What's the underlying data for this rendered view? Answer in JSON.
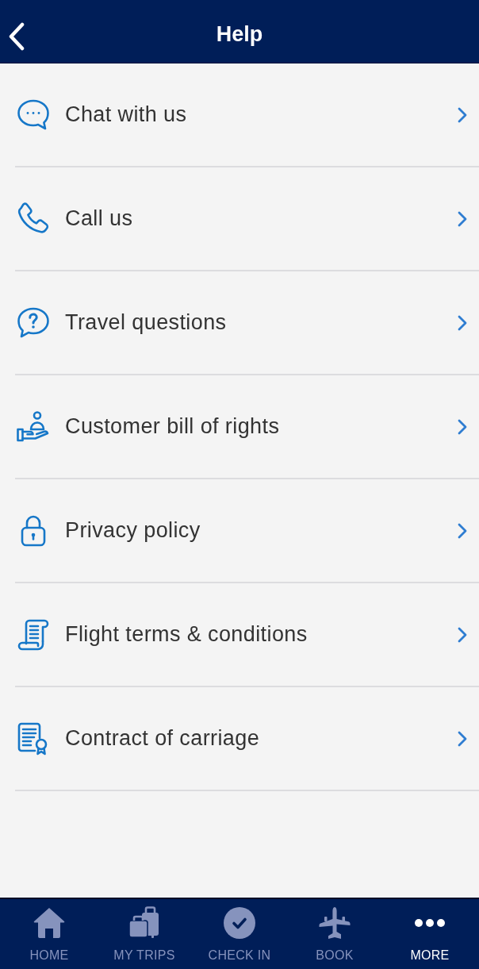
{
  "header": {
    "title": "Help"
  },
  "menu_items": [
    {
      "label": "Chat with us"
    },
    {
      "label": "Call us"
    },
    {
      "label": "Travel questions"
    },
    {
      "label": "Customer bill of rights"
    },
    {
      "label": "Privacy policy"
    },
    {
      "label": "Flight terms & conditions"
    },
    {
      "label": "Contract of carriage"
    }
  ],
  "tab_bar": [
    {
      "label": "HOME",
      "selected": false
    },
    {
      "label": "MY TRIPS",
      "selected": false
    },
    {
      "label": "CHECK IN",
      "selected": false
    },
    {
      "label": "BOOK",
      "selected": false
    },
    {
      "label": "MORE",
      "selected": true
    }
  ]
}
